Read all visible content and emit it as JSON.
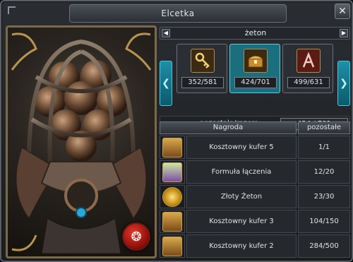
{
  "window": {
    "title": "Elcetka",
    "close_label": "✕"
  },
  "selector": {
    "label": "żeton",
    "prev_icon": "triangle-left-icon",
    "next_icon": "triangle-right-icon"
  },
  "slots": [
    {
      "count": "352/581",
      "icon": "key-icon"
    },
    {
      "count": "424/701",
      "icon": "chest-icon"
    },
    {
      "count": "499/631",
      "icon": "rune-icon"
    }
  ],
  "summary": {
    "label": "pozostałe/razem",
    "value": "424 / 701"
  },
  "table": {
    "headers": {
      "reward": "Nagroda",
      "remaining": "pozostałe"
    },
    "rows": [
      {
        "name": "Kosztowny kufer 5",
        "remaining": "1/1",
        "icon": "chest-icon"
      },
      {
        "name": "Formuła łączenia",
        "remaining": "12/20",
        "icon": "scroll-icon"
      },
      {
        "name": "Złoty Żeton",
        "remaining": "23/30",
        "icon": "gold-coin-icon"
      },
      {
        "name": "Kosztowny kufer 3",
        "remaining": "104/150",
        "icon": "chest-icon"
      },
      {
        "name": "Kosztowny kufer 2",
        "remaining": "284/500",
        "icon": "chest-icon"
      }
    ]
  },
  "colors": {
    "accent": "#1a6e7e",
    "frame": "#7b6a4a"
  }
}
